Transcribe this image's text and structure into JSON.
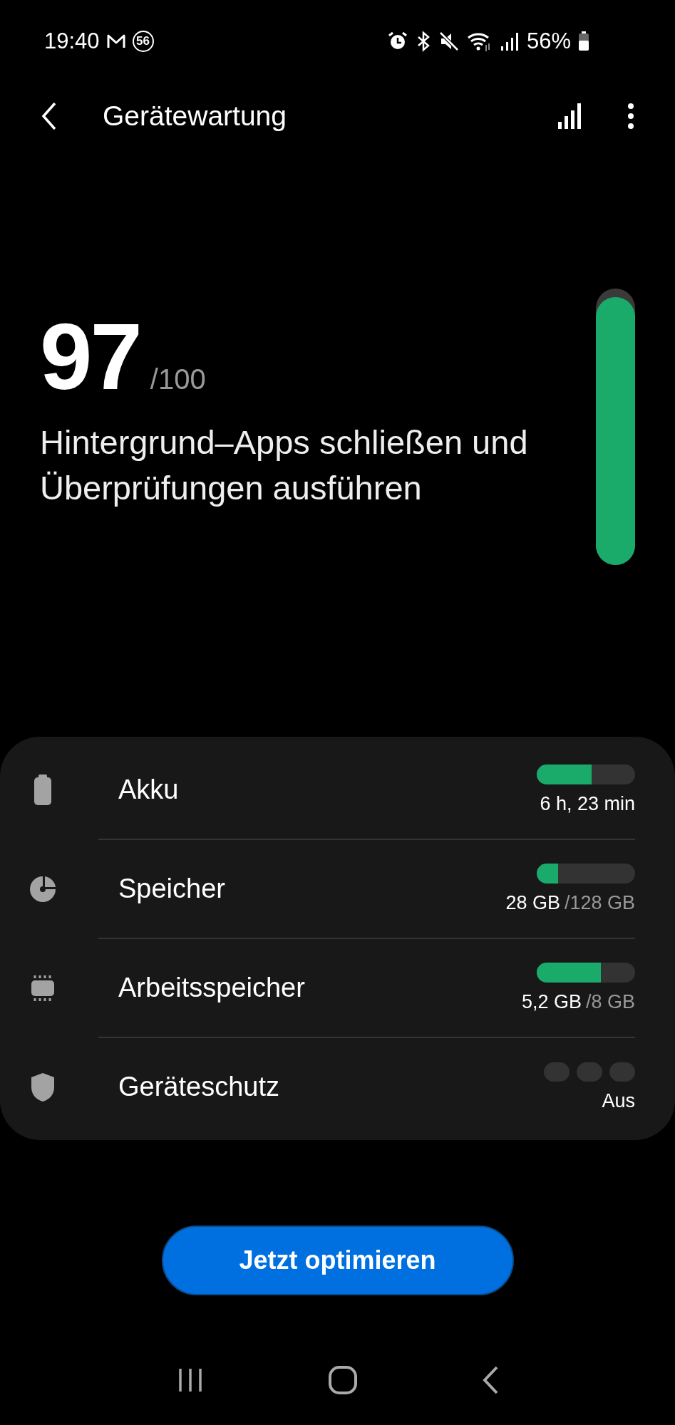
{
  "status_bar": {
    "time": "19:40",
    "notification_count": "56",
    "battery_percent": "56%"
  },
  "app_bar": {
    "title": "Gerätewartung"
  },
  "score": {
    "value": "97",
    "max": "/100",
    "level": 0.97
  },
  "message": "Hintergrund–Apps schließen und Überprüfungen ausführen",
  "items": [
    {
      "kind": "meter",
      "label": "Akku",
      "reading": "6 h, 23 min",
      "level": 0.56
    },
    {
      "kind": "meter",
      "label": "Speicher",
      "reading": "28 GB",
      "total": "/128 GB",
      "level": 0.22
    },
    {
      "kind": "meter",
      "label": "Arbeitsspeicher",
      "reading": "5,2 GB",
      "total": "/8 GB",
      "level": 0.65
    },
    {
      "kind": "steps",
      "label": "Geräteschutz",
      "reading": "Aus",
      "steps": [
        {
          "on": false
        },
        {
          "on": false
        },
        {
          "on": false
        }
      ]
    }
  ],
  "button": "Jetzt optimieren"
}
